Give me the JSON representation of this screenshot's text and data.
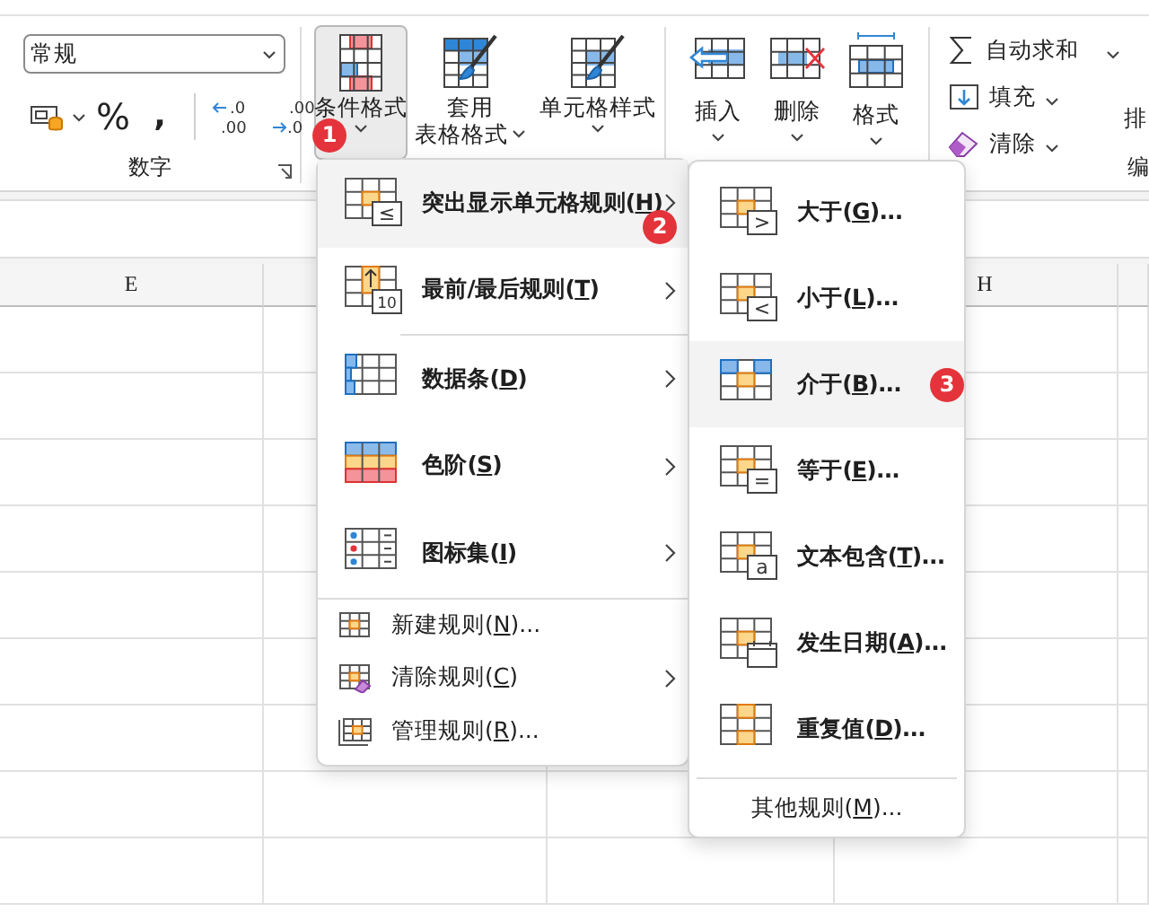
{
  "ribbon": {
    "number_format": {
      "value": "常规"
    },
    "number_tools": [
      {
        "kind": "currency"
      },
      {
        "kind": "percent",
        "glyph": "%"
      },
      {
        "kind": "comma",
        "glyph": ","
      },
      {
        "kind": "add_decimal",
        "lines": [
          ".0",
          ".00"
        ]
      },
      {
        "kind": "remove_decimal",
        "lines": [
          ".00",
          ".0"
        ]
      }
    ],
    "number_group_label": "数字",
    "style_buttons": [
      {
        "kind": "conditional",
        "lines": [
          "条件格式"
        ],
        "pressed": true,
        "step": "1"
      },
      {
        "kind": "table",
        "lines": [
          "套用",
          "表格格式"
        ],
        "pressed": false
      },
      {
        "kind": "cell",
        "lines": [
          "单元格样式"
        ],
        "pressed": false
      }
    ],
    "cell_buttons": [
      {
        "kind": "insert",
        "label": "插入"
      },
      {
        "kind": "delete",
        "label": "删除"
      },
      {
        "kind": "format",
        "label": "格式"
      }
    ],
    "edit_commands": [
      {
        "kind": "sum",
        "label": "自动求和"
      },
      {
        "kind": "fill",
        "label": "填充"
      },
      {
        "kind": "clear",
        "label": "清除"
      }
    ],
    "sort_cut": "排",
    "editing_group_label": "编"
  },
  "sheet": {
    "column_headers": [
      "E",
      "H"
    ]
  },
  "format_menu": {
    "groups": [
      {
        "items": [
          {
            "kind": "highlight",
            "glyph": "≤",
            "before": "突出显示单元格规则(",
            "key": "H",
            "after": ")",
            "submenu": true,
            "selected": true,
            "step": "2"
          },
          {
            "kind": "top_bottom",
            "glyph": "10",
            "before": "最前/最后规则(",
            "key": "T",
            "after": ")",
            "submenu": true,
            "selected": false
          }
        ]
      },
      {
        "items": [
          {
            "kind": "databar",
            "before": "数据条(",
            "key": "D",
            "after": ")",
            "submenu": true,
            "selected": false
          },
          {
            "kind": "color_scale",
            "before": "色阶(",
            "key": "S",
            "after": ")",
            "submenu": true,
            "selected": false
          },
          {
            "kind": "icon_set",
            "before": "图标集(",
            "key": "I",
            "after": ")",
            "submenu": true,
            "selected": false
          }
        ]
      },
      {
        "items": [
          {
            "kind": "new_rule",
            "before": "新建规则(",
            "key": "N",
            "after": ")...",
            "submenu": false,
            "selected": false
          },
          {
            "kind": "clear_rule",
            "before": "清除规则(",
            "key": "C",
            "after": ")",
            "submenu": true,
            "selected": false
          },
          {
            "kind": "manage_rule",
            "before": "管理规则(",
            "key": "R",
            "after": ")...",
            "submenu": false,
            "selected": false
          }
        ]
      }
    ]
  },
  "highlight_submenu": {
    "items": [
      {
        "kind": "highlight",
        "glyph": ">",
        "before": "大于(",
        "key": "G",
        "after": ")...",
        "selected": false
      },
      {
        "kind": "highlight",
        "glyph": "<",
        "before": "小于(",
        "key": "L",
        "after": ")...",
        "selected": false
      },
      {
        "kind": "between",
        "before": "介于(",
        "key": "B",
        "after": ")...",
        "selected": true,
        "step": "3"
      },
      {
        "kind": "highlight",
        "glyph": "=",
        "before": "等于(",
        "key": "E",
        "after": ")...",
        "selected": false
      },
      {
        "kind": "highlight",
        "glyph": "a",
        "before": "文本包含(",
        "key": "T",
        "after": ")...",
        "selected": false
      },
      {
        "kind": "date",
        "before": "发生日期(",
        "key": "A",
        "after": ")...",
        "selected": false
      },
      {
        "kind": "duplicate",
        "before": "重复值(",
        "key": "D",
        "after": ")...",
        "selected": false
      }
    ],
    "footer": {
      "before": "其他规则(",
      "key": "M",
      "after": ")..."
    }
  }
}
